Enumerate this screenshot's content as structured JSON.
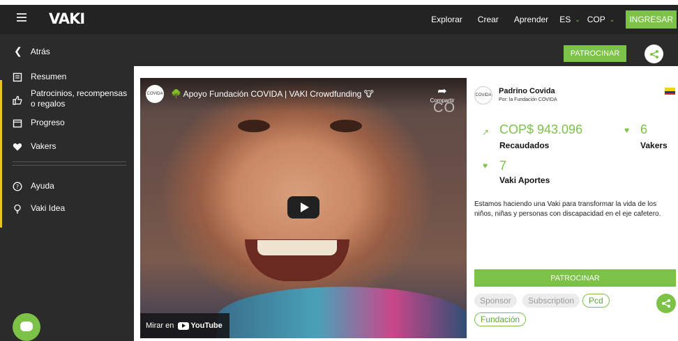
{
  "header": {
    "logo": "VAKI",
    "nav": [
      "Explorar",
      "Crear",
      "Aprender"
    ],
    "language": "ES",
    "currency": "COP",
    "login_label": "INGRESAR"
  },
  "subheader": {
    "back_label": "Atrás",
    "sponsor_label": "PATROCINAR"
  },
  "sidebar": {
    "items": [
      {
        "label": "Resumen",
        "icon": "summary-icon"
      },
      {
        "label": "Patrocinios, recompensas o regalos",
        "icon": "thumbs-up-icon"
      },
      {
        "label": "Progreso",
        "icon": "calendar-icon"
      },
      {
        "label": "Vakers",
        "icon": "heart-icon"
      }
    ],
    "secondary": [
      {
        "label": "Ayuda",
        "icon": "help-icon"
      },
      {
        "label": "Vaki Idea",
        "icon": "lightbulb-icon"
      }
    ]
  },
  "video": {
    "channel_avatar": "COVIDA",
    "title": "🌳 Apoyo Fundación COVIDA | VAKI Crowdfunding 🐮",
    "share_label": "Compartir",
    "watermark": "CO",
    "watch_on": "Mirar en",
    "youtube": "YouTube"
  },
  "campaign": {
    "org_avatar": "COVIDA",
    "org_name": "Padrino Covida",
    "org_sub": "Por: la Fundación COVIDA",
    "raised_amount": "COP$ 943.096",
    "raised_label": "Recaudados",
    "vakers_count": "6",
    "vakers_label": "Vakers",
    "aportes_count": "7",
    "aportes_label": "Vaki Aportes",
    "description": "Estamos haciendo una Vaki para transformar la vida de los niños, niñas y personas con discapacidad en el eje cafetero.",
    "sponsor_label": "PATROCINAR",
    "tags": [
      "Sponsor",
      "Subscription",
      "Pcd",
      "Fundación"
    ]
  },
  "colors": {
    "accent": "#7bc247",
    "header_bg": "#232323",
    "sidebar_bg": "#2b2b2b",
    "sidebar_marker": "#e8c32a"
  }
}
